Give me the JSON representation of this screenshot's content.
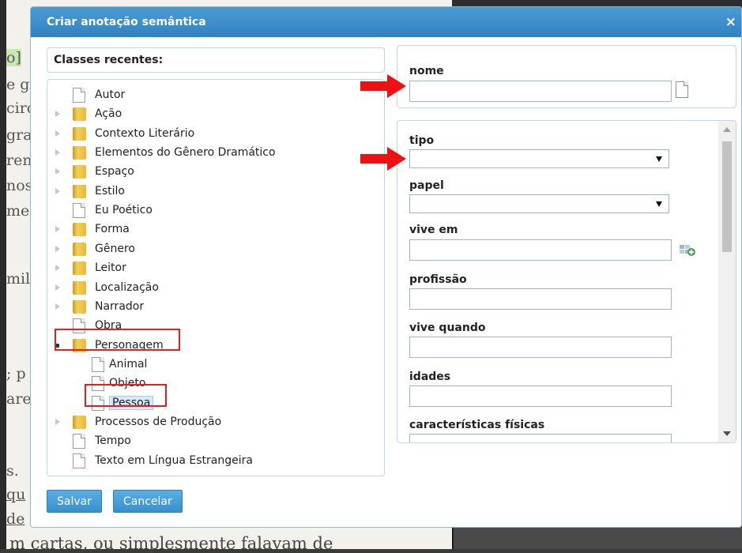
{
  "background": {
    "fragments": [
      "o]",
      "e g",
      "circ",
      "gra",
      "ren",
      "nos",
      "me",
      "mil",
      "; p",
      "are",
      "s.",
      "qu",
      "de"
    ],
    "bottom_text": "m cartas, ou simplesmente falavam de"
  },
  "dialog": {
    "title": "Criar anotação semântica",
    "close_label": "×",
    "recent_header": "Classes recentes:",
    "tree": [
      {
        "label": "Autor",
        "icon": "file-icon",
        "expander": "none",
        "indent": 0
      },
      {
        "label": "Ação",
        "icon": "folder-icon",
        "expander": "closed",
        "indent": 0
      },
      {
        "label": "Contexto Literário",
        "icon": "folder-icon",
        "expander": "closed",
        "indent": 0
      },
      {
        "label": "Elementos do Gênero Dramático",
        "icon": "folder-icon",
        "expander": "closed",
        "indent": 0
      },
      {
        "label": "Espaço",
        "icon": "folder-icon",
        "expander": "closed",
        "indent": 0
      },
      {
        "label": "Estilo",
        "icon": "folder-icon",
        "expander": "closed",
        "indent": 0
      },
      {
        "label": "Eu Poético",
        "icon": "file-icon",
        "expander": "none",
        "indent": 0
      },
      {
        "label": "Forma",
        "icon": "folder-icon",
        "expander": "closed",
        "indent": 0
      },
      {
        "label": "Gênero",
        "icon": "folder-icon",
        "expander": "closed",
        "indent": 0
      },
      {
        "label": "Leitor",
        "icon": "folder-icon",
        "expander": "closed",
        "indent": 0
      },
      {
        "label": "Localização",
        "icon": "folder-icon",
        "expander": "closed",
        "indent": 0
      },
      {
        "label": "Narrador",
        "icon": "folder-icon",
        "expander": "closed",
        "indent": 0
      },
      {
        "label": "Obra",
        "icon": "file-icon",
        "expander": "none",
        "indent": 0
      },
      {
        "label": "Personagem",
        "icon": "folder-icon",
        "expander": "open",
        "indent": 0,
        "highlighted": true
      },
      {
        "label": "Animal",
        "icon": "file-icon",
        "expander": "none",
        "indent": 1
      },
      {
        "label": "Objeto",
        "icon": "file-icon",
        "expander": "none",
        "indent": 1
      },
      {
        "label": "Pessoa",
        "icon": "file-icon",
        "expander": "none",
        "indent": 1,
        "selected": true,
        "highlighted": true
      },
      {
        "label": "Processos de Produção",
        "icon": "folder-icon",
        "expander": "closed",
        "indent": 0
      },
      {
        "label": "Tempo",
        "icon": "file-icon",
        "expander": "none",
        "indent": 0
      },
      {
        "label": "Texto em Língua Estrangeira",
        "icon": "file-icon",
        "expander": "none",
        "indent": 0
      }
    ],
    "fields": {
      "nome": {
        "label": "nome",
        "value": ""
      },
      "tipo": {
        "label": "tipo",
        "value": ""
      },
      "papel": {
        "label": "papel",
        "value": ""
      },
      "vive_em": {
        "label": "vive em",
        "value": ""
      },
      "profissao": {
        "label": "profissão",
        "value": ""
      },
      "vive_quando": {
        "label": "vive quando",
        "value": ""
      },
      "idades": {
        "label": "idades",
        "value": ""
      },
      "caracteristicas_fisicas": {
        "label": "características físicas",
        "value": ""
      }
    },
    "buttons": {
      "save": "Salvar",
      "cancel": "Cancelar"
    }
  },
  "colors": {
    "titlebar": "#3a8ccb",
    "button": "#3f96d3",
    "highlight_box": "#e02020",
    "selection": "#d6e9f8"
  }
}
